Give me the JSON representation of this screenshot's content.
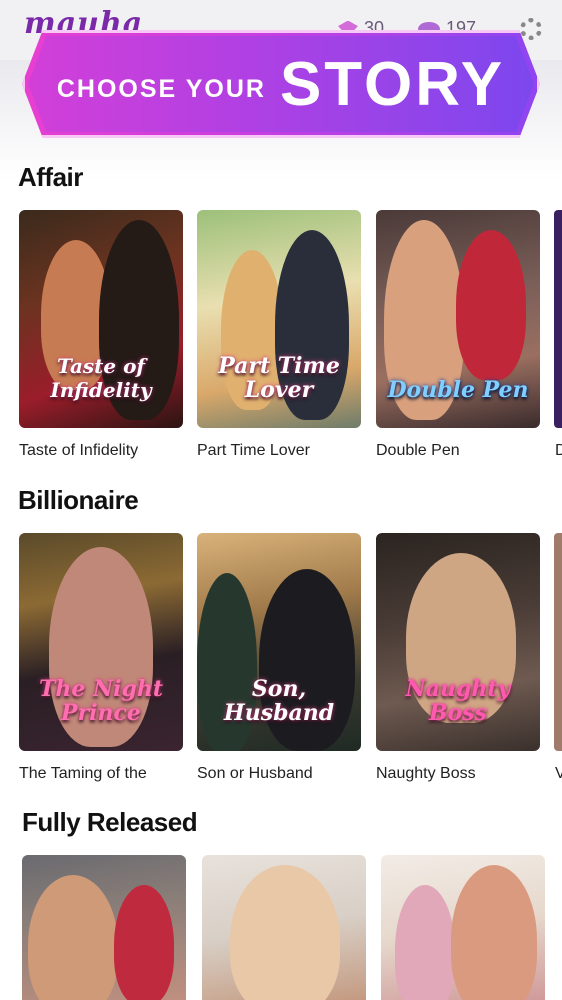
{
  "header": {
    "logo": "mauha",
    "gems": "30",
    "coins": "197",
    "gem_icon": "gem-icon",
    "coin_icon": "coin-icon",
    "settings_icon": "gear-icon"
  },
  "banner": {
    "small_text": "CHOOSE YOUR",
    "big_text": "STORY"
  },
  "sections": [
    {
      "title": "Affair",
      "stories": [
        {
          "caption": "Taste of Infidelity",
          "cover_title": "Taste of Infidelity"
        },
        {
          "caption": "Part Time Lover",
          "cover_title": "Part Time Lover"
        },
        {
          "caption": "Double Pen",
          "cover_title": "Double Pen"
        },
        {
          "caption": "D",
          "cover_title": ""
        }
      ]
    },
    {
      "title": "Billionaire",
      "stories": [
        {
          "caption": "The Taming of the",
          "cover_title": "The Night Prince"
        },
        {
          "caption": "Son or Husband",
          "cover_title": "Son, Husband"
        },
        {
          "caption": "Naughty Boss",
          "cover_title": "Naughty Boss"
        },
        {
          "caption": "V",
          "cover_title": ""
        }
      ]
    },
    {
      "title": "Fully Released",
      "stories": [
        {
          "caption": "",
          "cover_title": ""
        },
        {
          "caption": "",
          "cover_title": ""
        },
        {
          "caption": "",
          "cover_title": ""
        }
      ]
    }
  ],
  "colors": {
    "banner_start": "#e83fd0",
    "banner_end": "#8e45f0",
    "brand": "#7a2aa8"
  }
}
